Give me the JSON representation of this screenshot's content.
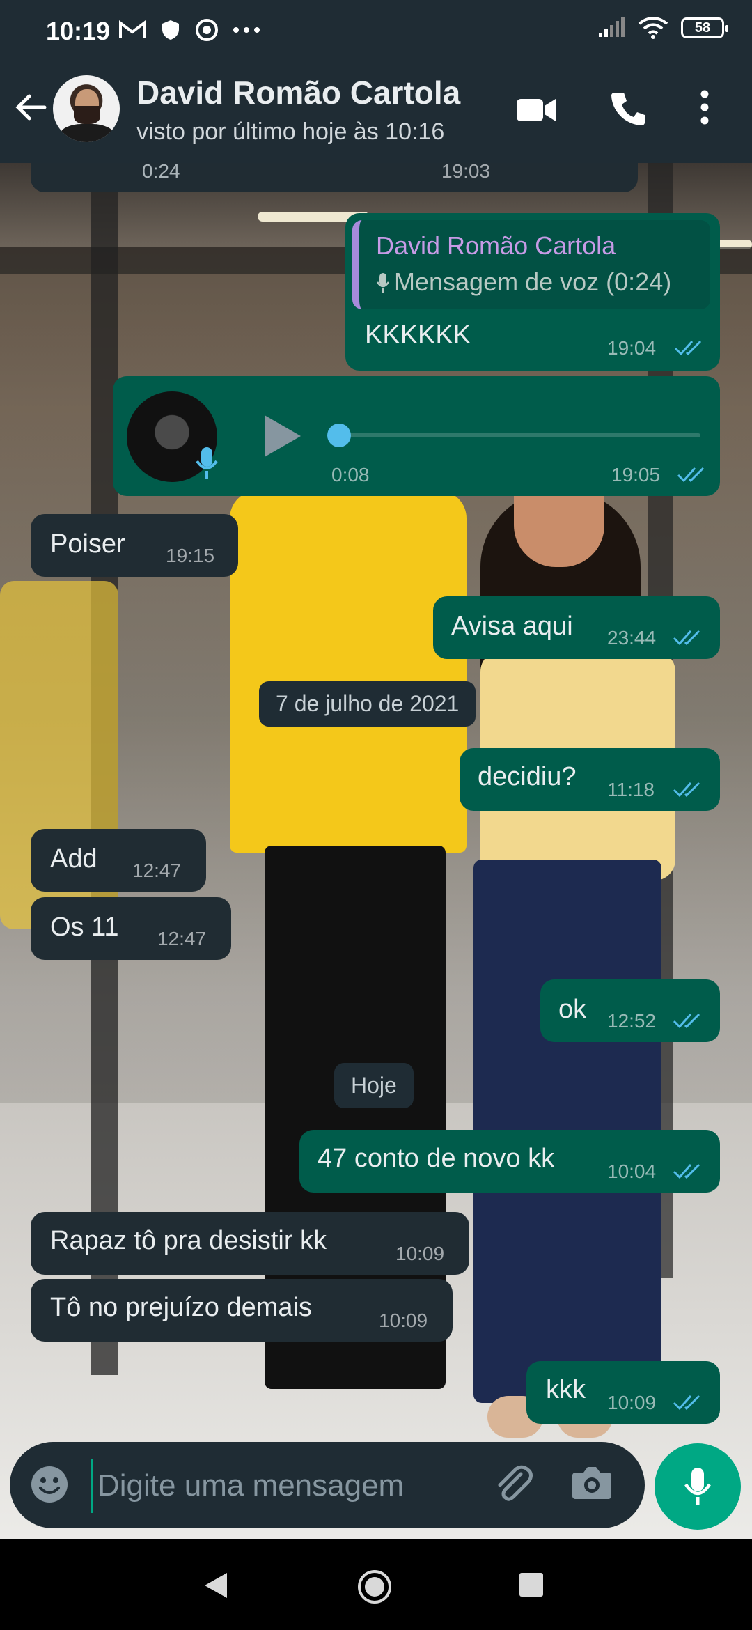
{
  "status_bar": {
    "time": "10:19",
    "battery": "58"
  },
  "header": {
    "contact_name": "David Romão Cartola",
    "last_seen": "visto por último hoje às 10:16"
  },
  "colors": {
    "header_bg": "#1f2c34",
    "incoming": "#202c33",
    "outgoing": "#005c4b",
    "accent": "#00a884",
    "read_ticks": "#53bdeb"
  },
  "icons": [
    "back-arrow-icon",
    "video-call-icon",
    "phone-icon",
    "more-vert-icon",
    "emoji-icon",
    "attach-icon",
    "camera-icon",
    "mic-icon"
  ],
  "messages": {
    "m0": {
      "duration": "0:24",
      "time": "19:03"
    },
    "m1": {
      "quote_name": "David Romão Cartola",
      "quote_text": "Mensagem de voz (0:24)",
      "text": "KKKKKK",
      "time": "19:04"
    },
    "m2": {
      "duration": "0:08",
      "time": "19:05"
    },
    "m3": {
      "text": "Poiser",
      "time": "19:15"
    },
    "m4": {
      "text": "Avisa aqui",
      "time": "23:44"
    },
    "date1": "7 de julho de 2021",
    "m5": {
      "text": "decidiu?",
      "time": "11:18"
    },
    "m6": {
      "text": "Add",
      "time": "12:47"
    },
    "m7": {
      "text": "Os 11",
      "time": "12:47"
    },
    "m8": {
      "text": "ok",
      "time": "12:52"
    },
    "date2": "Hoje",
    "m9": {
      "text": "47 conto de novo kk",
      "time": "10:04"
    },
    "m10": {
      "text": "Rapaz tô pra desistir kk",
      "time": "10:09"
    },
    "m11": {
      "text": "Tô no prejuízo demais",
      "time": "10:09"
    },
    "m12": {
      "text": "kkk",
      "time": "10:09"
    }
  },
  "composer": {
    "placeholder": "Digite uma mensagem"
  }
}
